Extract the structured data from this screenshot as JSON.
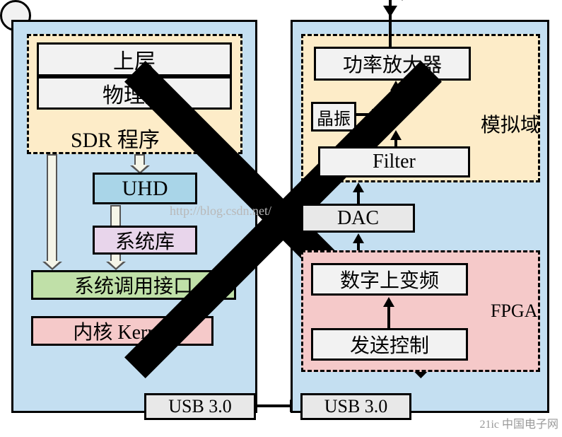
{
  "left": {
    "upper_layer": "上层",
    "phys_layer": "物理层",
    "sdr_label": "SDR 程序",
    "uhd": "UHD",
    "syslib": "系统库",
    "syscall": "系统调用接口",
    "kernel": "内核 Kernel",
    "usb": "USB 3.0"
  },
  "right": {
    "amp": "功率放大器",
    "osc": "晶振",
    "analog_label": "模拟域",
    "filter": "Filter",
    "dac": "DAC",
    "duc": "数字上变频",
    "txctl": "发送控制",
    "fpga_label": "FPGA",
    "usb": "USB 3.0"
  },
  "watermark": "http://blog.csdn.net/",
  "watermark2": "21ic 中国电子网"
}
